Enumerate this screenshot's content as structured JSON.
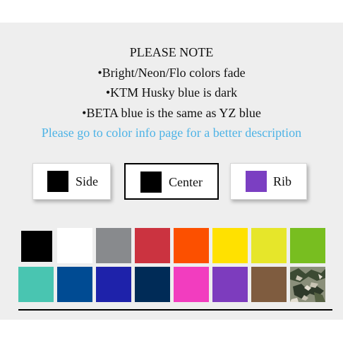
{
  "notes": {
    "heading": "PLEASE NOTE",
    "line1": "•Bright/Neon/Flo colors fade",
    "line2": "•KTM Husky blue is dark",
    "line3": "•BETA blue is the same as YZ blue",
    "link": "Please go to color info page for a better description"
  },
  "options": {
    "side": {
      "label": "Side",
      "color": "#000000"
    },
    "center": {
      "label": "Center",
      "color": "#000000"
    },
    "rib": {
      "label": "Rib",
      "color": "#7b3fc2"
    },
    "selected": "Center"
  },
  "swatches": {
    "row1": [
      "#000000",
      "#ffffff",
      "#888a8d",
      "#cb3340",
      "#fc5000",
      "#ffe100",
      "#e6e62a",
      "#78be20"
    ],
    "row2": [
      "#49c5b1",
      "#004b93",
      "#1e22aa",
      "#002b57",
      "#f23dbf",
      "#7d3cbe",
      "#7f5c3f",
      "camo"
    ]
  }
}
